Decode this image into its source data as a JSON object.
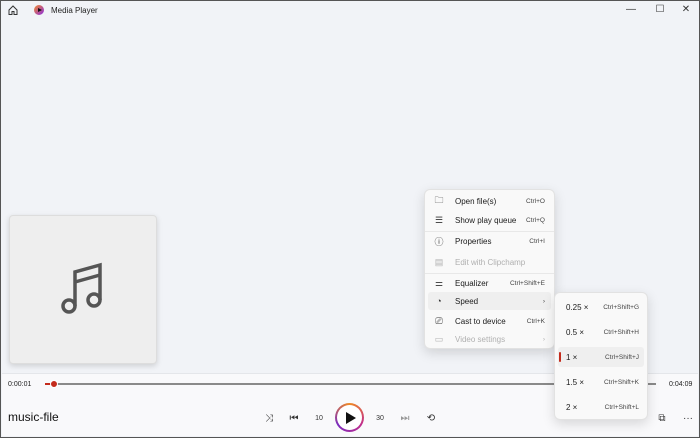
{
  "window": {
    "title": "Media Player",
    "controls": [
      "minimize",
      "maximize",
      "close"
    ]
  },
  "accent": "#c42b1c",
  "player": {
    "title": "music-file",
    "elapsed": "0:00:01",
    "duration": "0:04:09",
    "progress_fraction": 0.004,
    "rewind_label": "10",
    "forward_label": "30"
  },
  "menu": {
    "items": [
      {
        "label": "Open file(s)",
        "shortcut": "Ctrl+O",
        "icon": "folder-icon",
        "disabled": false
      },
      {
        "label": "Show play queue",
        "shortcut": "Ctrl+Q",
        "icon": "queue-icon",
        "disabled": false
      },
      {
        "label": "Properties",
        "shortcut": "Ctrl+I",
        "icon": "info-icon",
        "disabled": false
      },
      {
        "label": "Edit with Clipchamp",
        "shortcut": "",
        "icon": "clipchamp-icon",
        "disabled": true
      },
      {
        "label": "Equalizer",
        "shortcut": "Ctrl+Shift+E",
        "icon": "equalizer-icon",
        "disabled": false
      },
      {
        "label": "Speed",
        "shortcut": "›",
        "icon": "speed-icon",
        "disabled": false
      },
      {
        "label": "Cast to device",
        "shortcut": "Ctrl+K",
        "icon": "cast-icon",
        "disabled": false
      },
      {
        "label": "Video settings",
        "shortcut": "›",
        "icon": "video-icon",
        "disabled": true
      }
    ]
  },
  "speed_menu": {
    "selected": "1 ×",
    "items": [
      {
        "label": "0.25 ×",
        "shortcut": "Ctrl+Shift+G"
      },
      {
        "label": "0.5 ×",
        "shortcut": "Ctrl+Shift+H"
      },
      {
        "label": "1 ×",
        "shortcut": "Ctrl+Shift+J"
      },
      {
        "label": "1.5 ×",
        "shortcut": "Ctrl+Shift+K"
      },
      {
        "label": "2 ×",
        "shortcut": "Ctrl+Shift+L"
      }
    ]
  },
  "glyphs": {
    "minimize": "—",
    "maximize": "☐",
    "close": "✕",
    "shuffle": "⤨",
    "prev": "⏮",
    "next": "⏭",
    "repeat": "⟲",
    "more": "···",
    "miniplayer": "⧉",
    "folder": "🗀",
    "queue": "☰",
    "info": "ⓘ",
    "clip": "▤",
    "eq": "⚌",
    "speed": "◔",
    "cast": "⎚",
    "video": "▭"
  }
}
